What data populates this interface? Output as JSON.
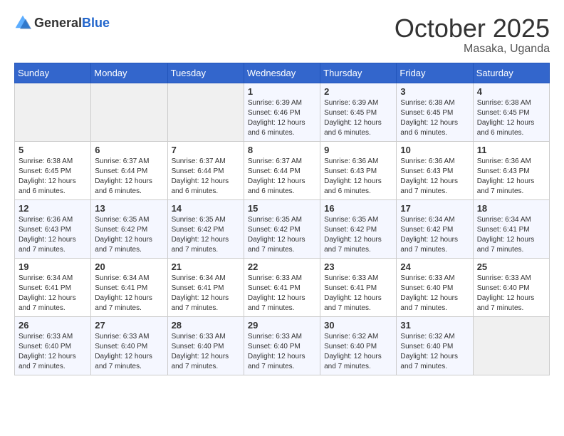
{
  "header": {
    "logo_general": "General",
    "logo_blue": "Blue",
    "month": "October 2025",
    "location": "Masaka, Uganda"
  },
  "weekdays": [
    "Sunday",
    "Monday",
    "Tuesday",
    "Wednesday",
    "Thursday",
    "Friday",
    "Saturday"
  ],
  "weeks": [
    [
      {
        "day": "",
        "info": ""
      },
      {
        "day": "",
        "info": ""
      },
      {
        "day": "",
        "info": ""
      },
      {
        "day": "1",
        "info": "Sunrise: 6:39 AM\nSunset: 6:46 PM\nDaylight: 12 hours and 6 minutes."
      },
      {
        "day": "2",
        "info": "Sunrise: 6:39 AM\nSunset: 6:45 PM\nDaylight: 12 hours and 6 minutes."
      },
      {
        "day": "3",
        "info": "Sunrise: 6:38 AM\nSunset: 6:45 PM\nDaylight: 12 hours and 6 minutes."
      },
      {
        "day": "4",
        "info": "Sunrise: 6:38 AM\nSunset: 6:45 PM\nDaylight: 12 hours and 6 minutes."
      }
    ],
    [
      {
        "day": "5",
        "info": "Sunrise: 6:38 AM\nSunset: 6:45 PM\nDaylight: 12 hours and 6 minutes."
      },
      {
        "day": "6",
        "info": "Sunrise: 6:37 AM\nSunset: 6:44 PM\nDaylight: 12 hours and 6 minutes."
      },
      {
        "day": "7",
        "info": "Sunrise: 6:37 AM\nSunset: 6:44 PM\nDaylight: 12 hours and 6 minutes."
      },
      {
        "day": "8",
        "info": "Sunrise: 6:37 AM\nSunset: 6:44 PM\nDaylight: 12 hours and 6 minutes."
      },
      {
        "day": "9",
        "info": "Sunrise: 6:36 AM\nSunset: 6:43 PM\nDaylight: 12 hours and 6 minutes."
      },
      {
        "day": "10",
        "info": "Sunrise: 6:36 AM\nSunset: 6:43 PM\nDaylight: 12 hours and 7 minutes."
      },
      {
        "day": "11",
        "info": "Sunrise: 6:36 AM\nSunset: 6:43 PM\nDaylight: 12 hours and 7 minutes."
      }
    ],
    [
      {
        "day": "12",
        "info": "Sunrise: 6:36 AM\nSunset: 6:43 PM\nDaylight: 12 hours and 7 minutes."
      },
      {
        "day": "13",
        "info": "Sunrise: 6:35 AM\nSunset: 6:42 PM\nDaylight: 12 hours and 7 minutes."
      },
      {
        "day": "14",
        "info": "Sunrise: 6:35 AM\nSunset: 6:42 PM\nDaylight: 12 hours and 7 minutes."
      },
      {
        "day": "15",
        "info": "Sunrise: 6:35 AM\nSunset: 6:42 PM\nDaylight: 12 hours and 7 minutes."
      },
      {
        "day": "16",
        "info": "Sunrise: 6:35 AM\nSunset: 6:42 PM\nDaylight: 12 hours and 7 minutes."
      },
      {
        "day": "17",
        "info": "Sunrise: 6:34 AM\nSunset: 6:42 PM\nDaylight: 12 hours and 7 minutes."
      },
      {
        "day": "18",
        "info": "Sunrise: 6:34 AM\nSunset: 6:41 PM\nDaylight: 12 hours and 7 minutes."
      }
    ],
    [
      {
        "day": "19",
        "info": "Sunrise: 6:34 AM\nSunset: 6:41 PM\nDaylight: 12 hours and 7 minutes."
      },
      {
        "day": "20",
        "info": "Sunrise: 6:34 AM\nSunset: 6:41 PM\nDaylight: 12 hours and 7 minutes."
      },
      {
        "day": "21",
        "info": "Sunrise: 6:34 AM\nSunset: 6:41 PM\nDaylight: 12 hours and 7 minutes."
      },
      {
        "day": "22",
        "info": "Sunrise: 6:33 AM\nSunset: 6:41 PM\nDaylight: 12 hours and 7 minutes."
      },
      {
        "day": "23",
        "info": "Sunrise: 6:33 AM\nSunset: 6:41 PM\nDaylight: 12 hours and 7 minutes."
      },
      {
        "day": "24",
        "info": "Sunrise: 6:33 AM\nSunset: 6:40 PM\nDaylight: 12 hours and 7 minutes."
      },
      {
        "day": "25",
        "info": "Sunrise: 6:33 AM\nSunset: 6:40 PM\nDaylight: 12 hours and 7 minutes."
      }
    ],
    [
      {
        "day": "26",
        "info": "Sunrise: 6:33 AM\nSunset: 6:40 PM\nDaylight: 12 hours and 7 minutes."
      },
      {
        "day": "27",
        "info": "Sunrise: 6:33 AM\nSunset: 6:40 PM\nDaylight: 12 hours and 7 minutes."
      },
      {
        "day": "28",
        "info": "Sunrise: 6:33 AM\nSunset: 6:40 PM\nDaylight: 12 hours and 7 minutes."
      },
      {
        "day": "29",
        "info": "Sunrise: 6:33 AM\nSunset: 6:40 PM\nDaylight: 12 hours and 7 minutes."
      },
      {
        "day": "30",
        "info": "Sunrise: 6:32 AM\nSunset: 6:40 PM\nDaylight: 12 hours and 7 minutes."
      },
      {
        "day": "31",
        "info": "Sunrise: 6:32 AM\nSunset: 6:40 PM\nDaylight: 12 hours and 7 minutes."
      },
      {
        "day": "",
        "info": ""
      }
    ]
  ]
}
